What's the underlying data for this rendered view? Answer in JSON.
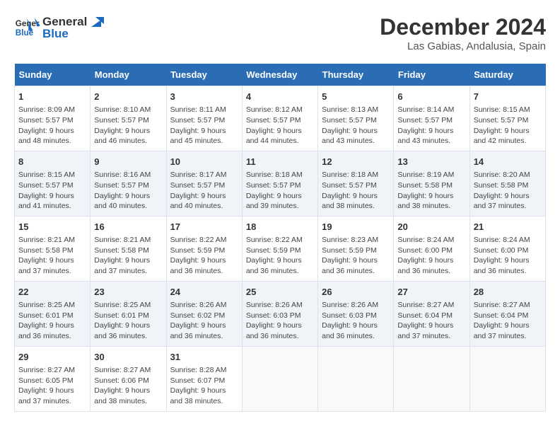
{
  "logo": {
    "line1": "General",
    "line2": "Blue"
  },
  "title": "December 2024",
  "subtitle": "Las Gabias, Andalusia, Spain",
  "days_header": [
    "Sunday",
    "Monday",
    "Tuesday",
    "Wednesday",
    "Thursday",
    "Friday",
    "Saturday"
  ],
  "weeks": [
    [
      {
        "day": "1",
        "sunrise": "8:09 AM",
        "sunset": "5:57 PM",
        "daylight": "9 hours and 48 minutes."
      },
      {
        "day": "2",
        "sunrise": "8:10 AM",
        "sunset": "5:57 PM",
        "daylight": "9 hours and 46 minutes."
      },
      {
        "day": "3",
        "sunrise": "8:11 AM",
        "sunset": "5:57 PM",
        "daylight": "9 hours and 45 minutes."
      },
      {
        "day": "4",
        "sunrise": "8:12 AM",
        "sunset": "5:57 PM",
        "daylight": "9 hours and 44 minutes."
      },
      {
        "day": "5",
        "sunrise": "8:13 AM",
        "sunset": "5:57 PM",
        "daylight": "9 hours and 43 minutes."
      },
      {
        "day": "6",
        "sunrise": "8:14 AM",
        "sunset": "5:57 PM",
        "daylight": "9 hours and 43 minutes."
      },
      {
        "day": "7",
        "sunrise": "8:15 AM",
        "sunset": "5:57 PM",
        "daylight": "9 hours and 42 minutes."
      }
    ],
    [
      {
        "day": "8",
        "sunrise": "8:15 AM",
        "sunset": "5:57 PM",
        "daylight": "9 hours and 41 minutes."
      },
      {
        "day": "9",
        "sunrise": "8:16 AM",
        "sunset": "5:57 PM",
        "daylight": "9 hours and 40 minutes."
      },
      {
        "day": "10",
        "sunrise": "8:17 AM",
        "sunset": "5:57 PM",
        "daylight": "9 hours and 40 minutes."
      },
      {
        "day": "11",
        "sunrise": "8:18 AM",
        "sunset": "5:57 PM",
        "daylight": "9 hours and 39 minutes."
      },
      {
        "day": "12",
        "sunrise": "8:18 AM",
        "sunset": "5:57 PM",
        "daylight": "9 hours and 38 minutes."
      },
      {
        "day": "13",
        "sunrise": "8:19 AM",
        "sunset": "5:58 PM",
        "daylight": "9 hours and 38 minutes."
      },
      {
        "day": "14",
        "sunrise": "8:20 AM",
        "sunset": "5:58 PM",
        "daylight": "9 hours and 37 minutes."
      }
    ],
    [
      {
        "day": "15",
        "sunrise": "8:21 AM",
        "sunset": "5:58 PM",
        "daylight": "9 hours and 37 minutes."
      },
      {
        "day": "16",
        "sunrise": "8:21 AM",
        "sunset": "5:58 PM",
        "daylight": "9 hours and 37 minutes."
      },
      {
        "day": "17",
        "sunrise": "8:22 AM",
        "sunset": "5:59 PM",
        "daylight": "9 hours and 36 minutes."
      },
      {
        "day": "18",
        "sunrise": "8:22 AM",
        "sunset": "5:59 PM",
        "daylight": "9 hours and 36 minutes."
      },
      {
        "day": "19",
        "sunrise": "8:23 AM",
        "sunset": "5:59 PM",
        "daylight": "9 hours and 36 minutes."
      },
      {
        "day": "20",
        "sunrise": "8:24 AM",
        "sunset": "6:00 PM",
        "daylight": "9 hours and 36 minutes."
      },
      {
        "day": "21",
        "sunrise": "8:24 AM",
        "sunset": "6:00 PM",
        "daylight": "9 hours and 36 minutes."
      }
    ],
    [
      {
        "day": "22",
        "sunrise": "8:25 AM",
        "sunset": "6:01 PM",
        "daylight": "9 hours and 36 minutes."
      },
      {
        "day": "23",
        "sunrise": "8:25 AM",
        "sunset": "6:01 PM",
        "daylight": "9 hours and 36 minutes."
      },
      {
        "day": "24",
        "sunrise": "8:26 AM",
        "sunset": "6:02 PM",
        "daylight": "9 hours and 36 minutes."
      },
      {
        "day": "25",
        "sunrise": "8:26 AM",
        "sunset": "6:03 PM",
        "daylight": "9 hours and 36 minutes."
      },
      {
        "day": "26",
        "sunrise": "8:26 AM",
        "sunset": "6:03 PM",
        "daylight": "9 hours and 36 minutes."
      },
      {
        "day": "27",
        "sunrise": "8:27 AM",
        "sunset": "6:04 PM",
        "daylight": "9 hours and 37 minutes."
      },
      {
        "day": "28",
        "sunrise": "8:27 AM",
        "sunset": "6:04 PM",
        "daylight": "9 hours and 37 minutes."
      }
    ],
    [
      {
        "day": "29",
        "sunrise": "8:27 AM",
        "sunset": "6:05 PM",
        "daylight": "9 hours and 37 minutes."
      },
      {
        "day": "30",
        "sunrise": "8:27 AM",
        "sunset": "6:06 PM",
        "daylight": "9 hours and 38 minutes."
      },
      {
        "day": "31",
        "sunrise": "8:28 AM",
        "sunset": "6:07 PM",
        "daylight": "9 hours and 38 minutes."
      },
      null,
      null,
      null,
      null
    ]
  ]
}
